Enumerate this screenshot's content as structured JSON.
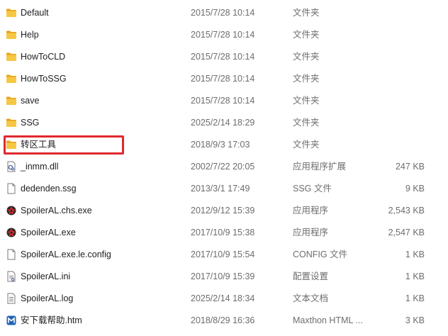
{
  "files": [
    {
      "name": "Default",
      "date": "2015/7/28 10:14",
      "type": "文件夹",
      "size": "",
      "icon": "folder-icon"
    },
    {
      "name": "Help",
      "date": "2015/7/28 10:14",
      "type": "文件夹",
      "size": "",
      "icon": "folder-icon"
    },
    {
      "name": "HowToCLD",
      "date": "2015/7/28 10:14",
      "type": "文件夹",
      "size": "",
      "icon": "folder-icon"
    },
    {
      "name": "HowToSSG",
      "date": "2015/7/28 10:14",
      "type": "文件夹",
      "size": "",
      "icon": "folder-icon"
    },
    {
      "name": "save",
      "date": "2015/7/28 10:14",
      "type": "文件夹",
      "size": "",
      "icon": "folder-icon"
    },
    {
      "name": "SSG",
      "date": "2025/2/14 18:29",
      "type": "文件夹",
      "size": "",
      "icon": "folder-icon"
    },
    {
      "name": "转区工具",
      "date": "2018/9/3 17:03",
      "type": "文件夹",
      "size": "",
      "icon": "folder-icon"
    },
    {
      "name": "_inmm.dll",
      "date": "2002/7/22 20:05",
      "type": "应用程序扩展",
      "size": "247 KB",
      "icon": "dll-file-icon"
    },
    {
      "name": "dedenden.ssg",
      "date": "2013/3/1 17:49",
      "type": "SSG 文件",
      "size": "9 KB",
      "icon": "blank-file-icon"
    },
    {
      "name": "SpoilerAL.chs.exe",
      "date": "2012/9/12 15:39",
      "type": "应用程序",
      "size": "2,543 KB",
      "icon": "app-exe-icon"
    },
    {
      "name": "SpoilerAL.exe",
      "date": "2017/10/9 15:38",
      "type": "应用程序",
      "size": "2,547 KB",
      "icon": "app-exe-icon"
    },
    {
      "name": "SpoilerAL.exe.le.config",
      "date": "2017/10/9 15:54",
      "type": "CONFIG 文件",
      "size": "1 KB",
      "icon": "blank-file-icon"
    },
    {
      "name": "SpoilerAL.ini",
      "date": "2017/10/9 15:39",
      "type": "配置设置",
      "size": "1 KB",
      "icon": "ini-file-icon"
    },
    {
      "name": "SpoilerAL.log",
      "date": "2025/2/14 18:34",
      "type": "文本文档",
      "size": "1 KB",
      "icon": "text-file-icon"
    },
    {
      "name": "安下载帮助.htm",
      "date": "2018/8/29 16:36",
      "type": "Maxthon HTML ...",
      "size": "3 KB",
      "icon": "maxthon-html-icon"
    }
  ],
  "highlight_color": "#e0282f",
  "folder_color": "#f7c744"
}
